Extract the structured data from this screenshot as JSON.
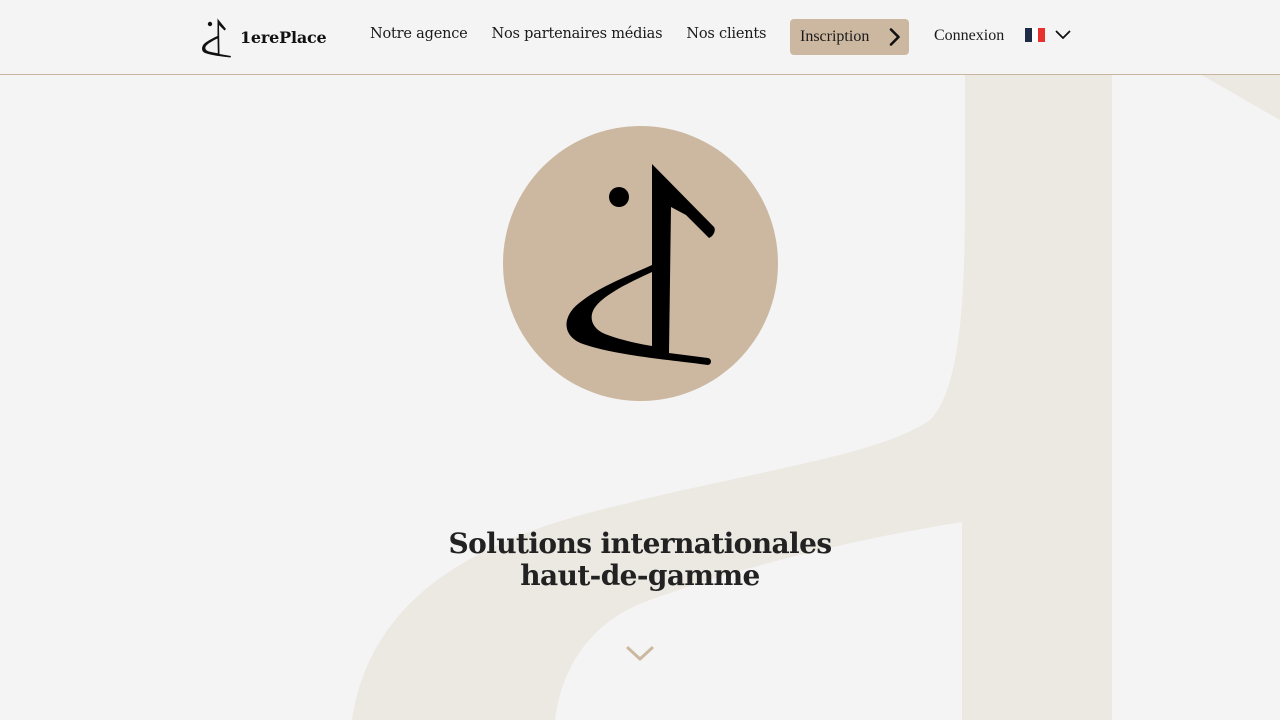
{
  "brand": {
    "name": "1erePlace",
    "logo_icon": "notation-d-logo-icon"
  },
  "nav": {
    "items": [
      {
        "label": "Notre agence"
      },
      {
        "label": "Nos partenaires médias"
      },
      {
        "label": "Nos clients"
      }
    ]
  },
  "header": {
    "signup_label": "Inscription",
    "signup_icon": "chevron-right-icon",
    "login_label": "Connexion",
    "language": {
      "selected": "fr",
      "flag_colors": [
        "#1f2a44",
        "#ffffff",
        "#e8302f"
      ],
      "icon": "chevron-down-icon"
    }
  },
  "hero": {
    "title_line1": "Solutions internationales",
    "title_line2": "haut-de-gamme",
    "scroll_icon": "chevron-down-icon"
  },
  "colors": {
    "accent": "#ccb8a0",
    "background": "#f4f4f4",
    "decor": "#ece8e2",
    "text": "#1a1a1a"
  }
}
